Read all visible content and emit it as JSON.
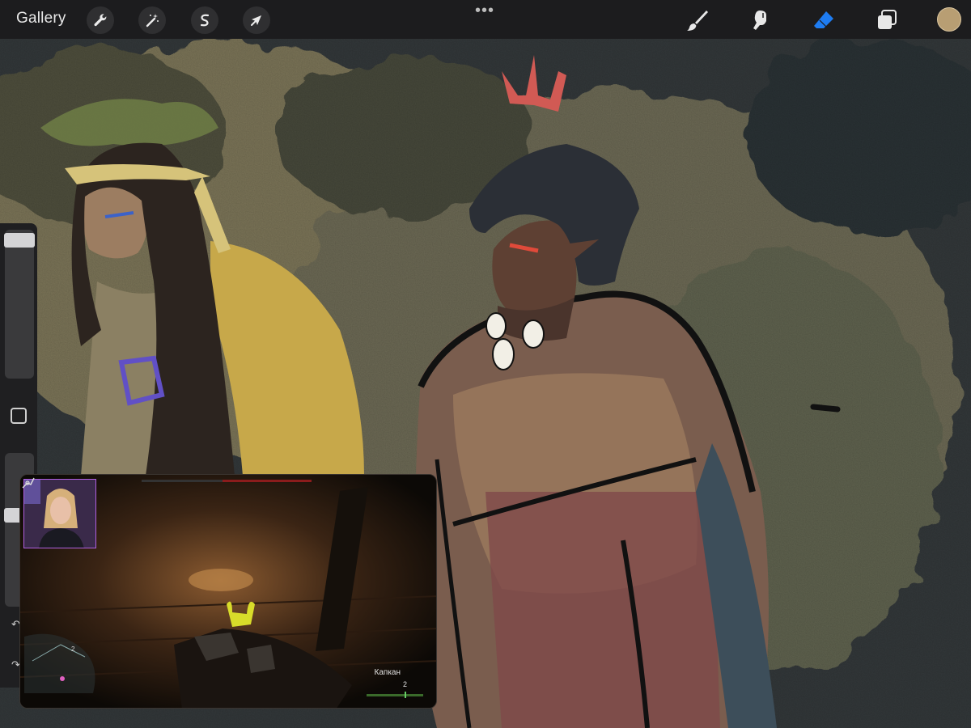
{
  "topbar": {
    "gallery_label": "Gallery",
    "left_tools": [
      {
        "name": "wrench-icon",
        "label": "Actions"
      },
      {
        "name": "magic-wand-icon",
        "label": "Adjustments"
      },
      {
        "name": "selection-s-icon",
        "label": "Selection"
      },
      {
        "name": "arrow-cursor-icon",
        "label": "Transform"
      }
    ],
    "more_label": "•••",
    "right_tools": [
      {
        "name": "brush-icon",
        "active": false
      },
      {
        "name": "smudge-icon",
        "active": false
      },
      {
        "name": "eraser-icon",
        "active": true
      },
      {
        "name": "layers-icon",
        "active": false
      }
    ],
    "current_color": "#b89e73",
    "accent_color": "#1e7cf2"
  },
  "sidebar": {
    "brush_size_level": 0.0,
    "opacity_level": 0.6
  },
  "stream_overlay": {
    "item_label": "Капкан",
    "item_count": "2",
    "minimap_marker": "2"
  }
}
